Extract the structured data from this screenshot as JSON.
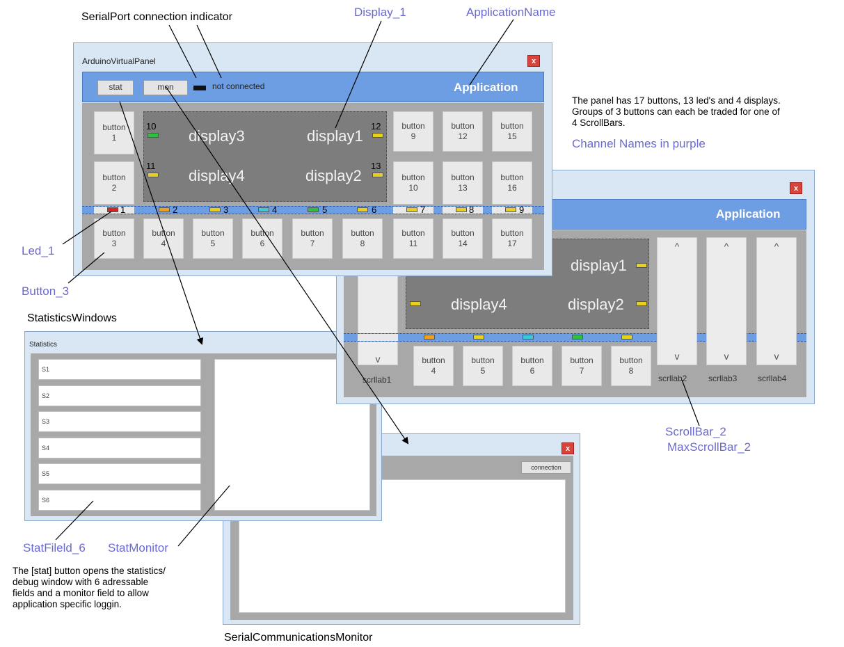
{
  "annotations": {
    "serialport_indicator": "SerialPort connection indicator",
    "display_1": "Display_1",
    "application_name": "ApplicationName",
    "led_1": "Led_1",
    "button_3": "Button_3",
    "statistics_windows": "StatisticsWindows",
    "statfield_6": "StatFileld_6",
    "stat_monitor": "StatMonitor",
    "serial_comm_monitor": "SerialCommunicationsMonitor",
    "scrollbar_2": "ScrollBar_2",
    "maxscrollbar_2": "MaxScrollBar_2",
    "channel_names": "Channel Names in purple",
    "panel_note": [
      "The panel has 17 buttons, 13 led's and 4 displays.",
      "Groups of 3 buttons can each be traded for one of",
      "4 ScrollBars."
    ],
    "stat_note": [
      "The [stat] button opens the statistics/",
      "debug window with 6 adressable",
      "fields and a monitor field to allow",
      "application specific loggin."
    ]
  },
  "main_panel": {
    "title": "ArduinoVirtualPanel",
    "close": "x",
    "stat_label": "stat",
    "mon_label": "mon",
    "status": "not connected",
    "app_name": "Application",
    "displays": [
      "display3",
      "display1",
      "display4",
      "display2"
    ],
    "buttons": {
      "b1": [
        "button",
        "1"
      ],
      "b2": [
        "button",
        "2"
      ],
      "b3": [
        "button",
        "3"
      ],
      "b4": [
        "button",
        "4"
      ],
      "b5": [
        "button",
        "5"
      ],
      "b6": [
        "button",
        "6"
      ],
      "b7": [
        "button",
        "7"
      ],
      "b8": [
        "button",
        "8"
      ],
      "b9": [
        "button",
        "9"
      ],
      "b10": [
        "button",
        "10"
      ],
      "b11": [
        "button",
        "11"
      ],
      "b12": [
        "button",
        "12"
      ],
      "b13": [
        "button",
        "13"
      ],
      "b14": [
        "button",
        "14"
      ],
      "b15": [
        "button",
        "15"
      ],
      "b16": [
        "button",
        "16"
      ],
      "b17": [
        "button",
        "17"
      ]
    },
    "led_numbers": [
      "1",
      "2",
      "3",
      "4",
      "5",
      "6",
      "7",
      "8",
      "9",
      "10",
      "11",
      "12",
      "13"
    ],
    "led_colors": [
      "#e02020",
      "#f0a020",
      "#e8d020",
      "#40c8d8",
      "#30c040",
      "#e8d020",
      "#e8d020",
      "#e8d020",
      "#e8d020",
      "#30c040",
      "#e8d020",
      "#e8d020",
      "#e8d020"
    ]
  },
  "scroll_panel": {
    "close": "x",
    "app_name": "Application",
    "displays": [
      "display1",
      "display4",
      "display2"
    ],
    "buttons": {
      "b4": [
        "button",
        "4"
      ],
      "b5": [
        "button",
        "5"
      ],
      "b6": [
        "button",
        "6"
      ],
      "b7": [
        "button",
        "7"
      ],
      "b8": [
        "button",
        "8"
      ]
    },
    "scroll_labels": [
      "scrllab1",
      "scrllab2",
      "scrllab3",
      "scrllab4"
    ],
    "up_arrow": "^",
    "down_arrow": "v"
  },
  "stats_window": {
    "title": "Statistics",
    "fields": [
      "S1",
      "S2",
      "S3",
      "S4",
      "S5",
      "S6"
    ]
  },
  "serial_window": {
    "close": "x",
    "connection_label": "connection"
  }
}
